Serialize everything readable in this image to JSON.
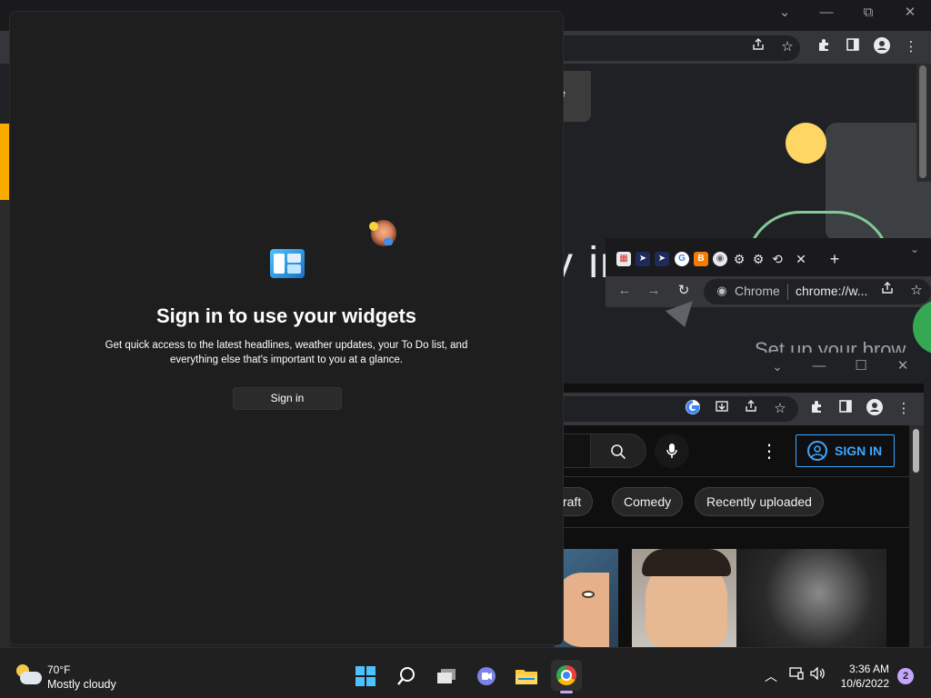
{
  "widgets_panel": {
    "title": "Sign in to use your widgets",
    "description": "Get quick access to the latest headlines, weather updates, your To Do list, and everything else that's important to you at a glance.",
    "signin_label": "Sign in"
  },
  "background_window_1": {
    "card_text": "e",
    "page_text": "y in",
    "window_controls": {
      "dropdown": "⌄",
      "minimize": "—",
      "restore": "⧉",
      "close": "✕"
    }
  },
  "background_window_2": {
    "omnibox_site": "Chrome",
    "omnibox_url": "chrome://w...",
    "ghost_text": "Set up your brow",
    "favicons": [
      "screenshot",
      "cursor",
      "cursor",
      "G",
      "B",
      "chrome",
      "gear",
      "gear",
      "history"
    ]
  },
  "youtube": {
    "signin_label": "SIGN IN",
    "chips": [
      "craft",
      "Comedy",
      "Recently uploaded"
    ]
  },
  "taskbar": {
    "weather_temp": "70°F",
    "weather_condition": "Mostly cloudy",
    "time": "3:36 AM",
    "date": "10/6/2022",
    "notification_count": "2",
    "accent": "#c5a6ff"
  }
}
